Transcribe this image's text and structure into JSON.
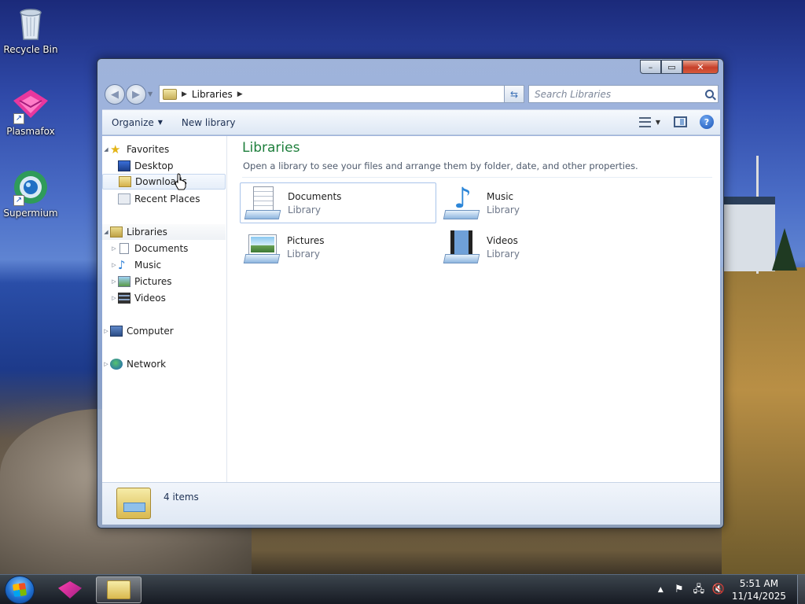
{
  "desktop": {
    "icons": [
      {
        "label": "Recycle Bin",
        "icon": "recycle-bin-icon"
      },
      {
        "label": "Plasmafox",
        "icon": "plasmafox-icon"
      },
      {
        "label": "Supermium",
        "icon": "supermium-icon"
      }
    ]
  },
  "window": {
    "controls": {
      "minimize": "–",
      "maximize": "▭",
      "close": "✕"
    },
    "address": {
      "segments": [
        "Libraries"
      ],
      "refresh_icon": "refresh-icon"
    },
    "search": {
      "placeholder": "Search Libraries"
    },
    "toolbar": {
      "organize": "Organize",
      "new_library": "New library",
      "help_symbol": "?"
    },
    "nav": {
      "favorites": {
        "label": "Favorites",
        "items": [
          "Desktop",
          "Downloads",
          "Recent Places"
        ]
      },
      "libraries": {
        "label": "Libraries",
        "items": [
          "Documents",
          "Music",
          "Pictures",
          "Videos"
        ]
      },
      "computer": "Computer",
      "network": "Network"
    },
    "main": {
      "title": "Libraries",
      "subtitle": "Open a library to see your files and arrange them by folder, date, and other properties.",
      "libraries": [
        {
          "name": "Documents",
          "kind": "Library",
          "icon": "documents-library-icon",
          "selected": true
        },
        {
          "name": "Music",
          "kind": "Library",
          "icon": "music-library-icon",
          "selected": false
        },
        {
          "name": "Pictures",
          "kind": "Library",
          "icon": "pictures-library-icon",
          "selected": false
        },
        {
          "name": "Videos",
          "kind": "Library",
          "icon": "videos-library-icon",
          "selected": false
        }
      ]
    },
    "status": {
      "item_count": "4 items"
    }
  },
  "taskbar": {
    "apps": [
      "Plasmafox",
      "Windows Explorer"
    ],
    "clock": {
      "time": "5:51 AM",
      "date": "11/14/2025"
    },
    "tray_icons": [
      "show-hidden-icons-arrow",
      "action-center-flag-icon",
      "network-icon",
      "volume-muted-icon"
    ]
  }
}
